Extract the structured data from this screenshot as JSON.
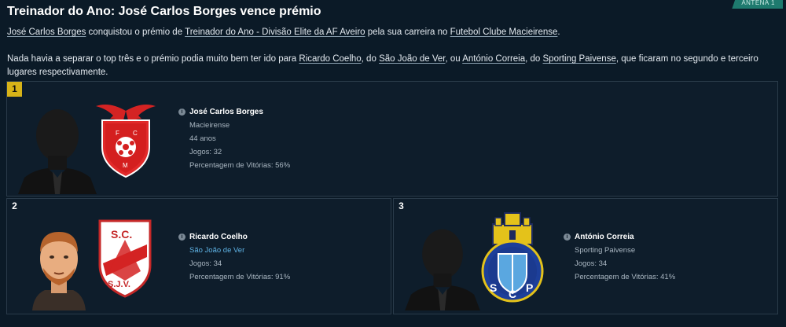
{
  "tag": "ANTENA 1",
  "title": "Treinador do Ano: José Carlos Borges vence prémio",
  "paragraph1": {
    "coach": "José Carlos Borges",
    "t1": " conquistou o prémio de ",
    "award": "Treinador do Ano - Divisão Elite da AF Aveiro",
    "t2": " pela sua carreira no ",
    "club": "Futebol Clube Macieirense",
    "t3": "."
  },
  "paragraph2": {
    "t1": "Nada havia a separar o top três e o prémio podia muito bem ter ido para ",
    "coach2": "Ricardo Coelho",
    "t2": ", do ",
    "club2": "São João de Ver",
    "t3": ", ou ",
    "coach3": "António Correia",
    "t4": ", do ",
    "club3": "Sporting Paivense",
    "t5": ", que ficaram no segundo e terceiro lugares respectivamente."
  },
  "candidates": [
    {
      "rank": "1",
      "name": "José Carlos Borges",
      "club": "Macieirense",
      "age": "44 anos",
      "games": "Jogos: 32",
      "win_pct": "Percentagem de Vitórias: 56%"
    },
    {
      "rank": "2",
      "name": "Ricardo Coelho",
      "club": "São João de Ver",
      "games": "Jogos: 34",
      "win_pct": "Percentagem de Vitórias: 91%"
    },
    {
      "rank": "3",
      "name": "António Correia",
      "club": "Sporting Paivense",
      "games": "Jogos: 34",
      "win_pct": "Percentagem de Vitórias: 41%"
    }
  ],
  "crest_letters": {
    "macieirense": [
      "F",
      "C",
      "M"
    ],
    "sjv_top": "S.C.",
    "sjv_bottom": "S.J.V.",
    "paivense": [
      "S",
      "C",
      "P"
    ]
  },
  "colors": {
    "gold_rank": "#d7b318",
    "link": "#5fb4e6",
    "background": "#0b1a27"
  }
}
